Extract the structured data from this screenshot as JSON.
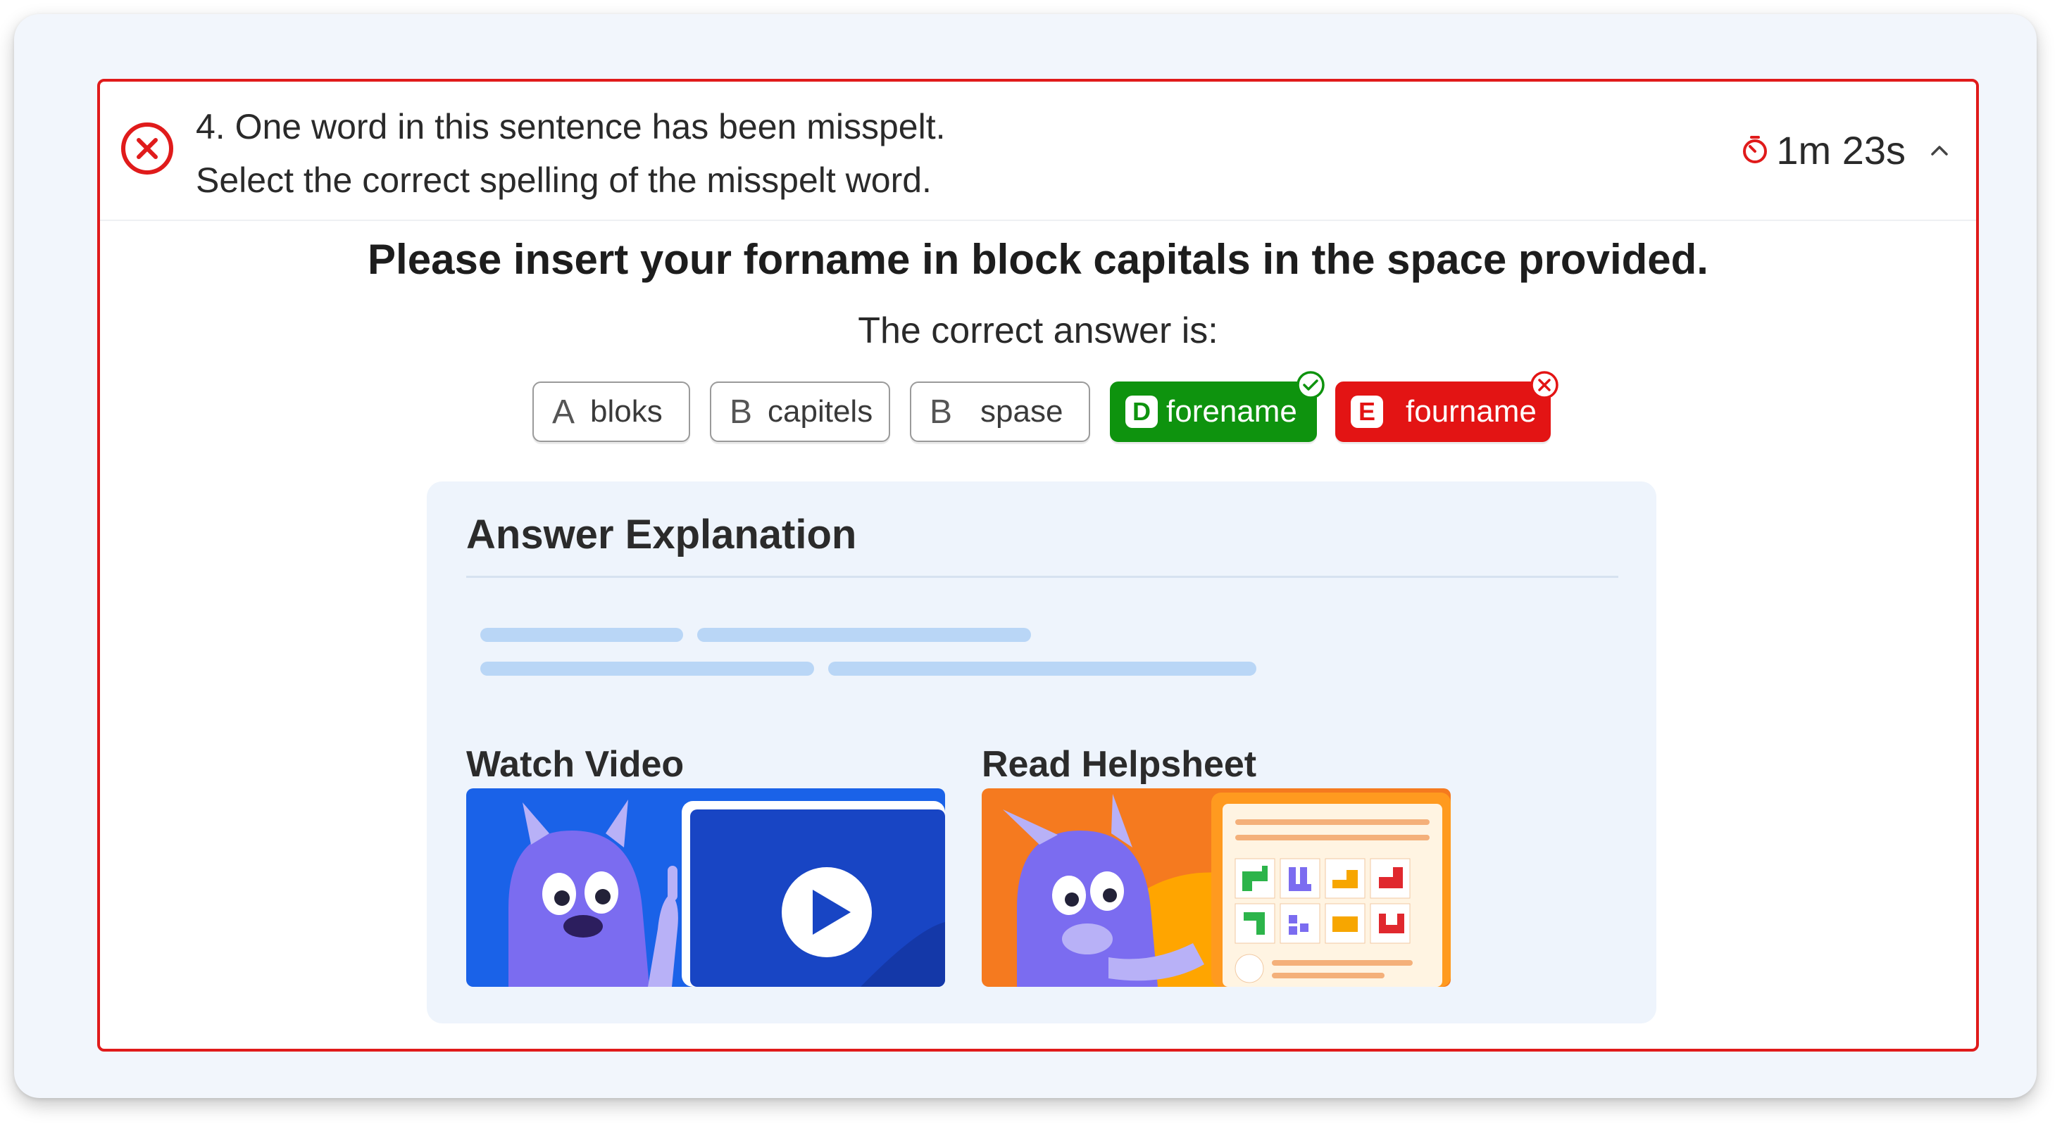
{
  "question": {
    "status": "incorrect",
    "number": "4.",
    "line1": "4. One word in this sentence has been misspelt.",
    "line2": "Select the correct spelling of the misspelt word.",
    "timer": "1m 23s"
  },
  "sentence": "Please insert your forname in block capitals in the space provided.",
  "answer_label": "The correct answer is:",
  "options": [
    {
      "letter": "A",
      "text": "bloks",
      "state": "default"
    },
    {
      "letter": "B",
      "text": "capitels",
      "state": "default"
    },
    {
      "letter": "B",
      "text": "spase",
      "state": "default"
    },
    {
      "letter": "D",
      "text": "forename",
      "state": "correct"
    },
    {
      "letter": "E",
      "text": "fourname",
      "state": "wrong"
    }
  ],
  "explanation": {
    "title": "Answer Explanation",
    "video_label": "Watch Video",
    "helpsheet_label": "Read Helpsheet"
  },
  "colors": {
    "error": "#e01b1b",
    "correct": "#0e930e",
    "card_bg": "#f2f6fc",
    "explanation_bg": "#eef4fc",
    "skeleton": "#b9d6f6",
    "video_blue": "#1a62e8",
    "helpsheet_orange": "#f57a1f",
    "monster_purple": "#7b6cf0"
  },
  "icons": [
    "close-circle-icon",
    "timer-icon",
    "chevron-up-icon",
    "check-circle-icon",
    "x-circle-icon",
    "play-icon"
  ]
}
